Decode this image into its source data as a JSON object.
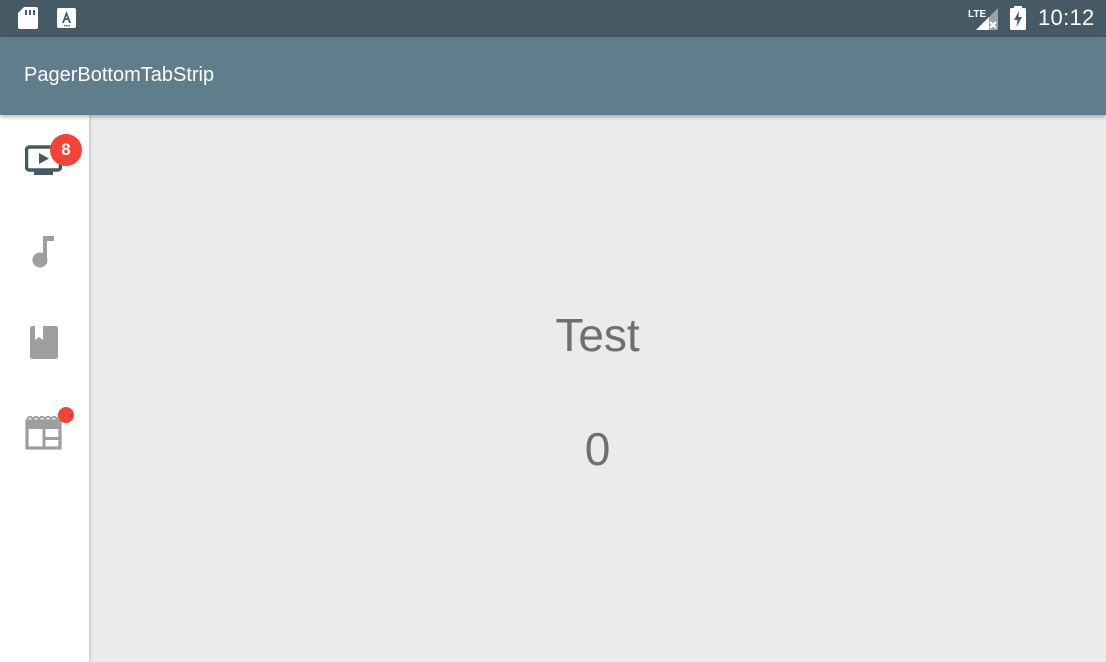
{
  "status_bar": {
    "time": "10:12",
    "network_label": "LTE",
    "icons": [
      "sd-card-icon",
      "font-download-icon",
      "signal-lte-icon",
      "battery-charging-icon"
    ]
  },
  "app_bar": {
    "title": "PagerBottomTabStrip"
  },
  "tabs": [
    {
      "icon": "tv-play-icon",
      "selected": true,
      "badge": "8"
    },
    {
      "icon": "music-note-icon",
      "selected": false,
      "badge": ""
    },
    {
      "icon": "book-icon",
      "selected": false,
      "badge": ""
    },
    {
      "icon": "newspaper-icon",
      "selected": false,
      "badge_dot": true
    }
  ],
  "content": {
    "title": "Test",
    "count": "0"
  },
  "colors": {
    "status_bar": "#455a64",
    "app_bar": "#607d8b",
    "tab_active": "#455a64",
    "tab_inactive": "#9e9e9e",
    "badge": "#f44336",
    "content_background": "#ebebeb",
    "content_text": "#6f6f6f"
  }
}
